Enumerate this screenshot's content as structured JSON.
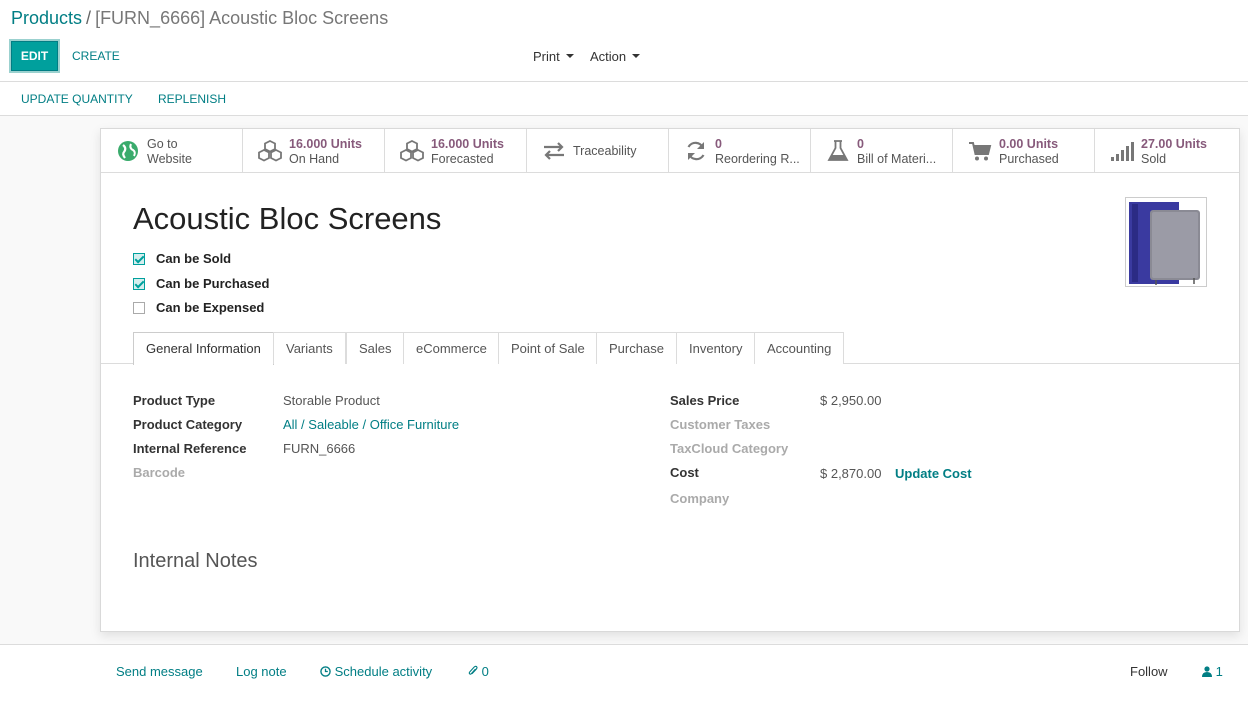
{
  "breadcrumb": {
    "parent": "Products",
    "separator": "/",
    "current": "[FURN_6666] Acoustic Bloc Screens"
  },
  "toolbar": {
    "edit_label": "EDIT",
    "create_label": "CREATE",
    "print_label": "Print",
    "action_label": "Action"
  },
  "status_buttons": {
    "update_quantity": "UPDATE QUANTITY",
    "replenish": "REPLENISH"
  },
  "smart_buttons": [
    {
      "value": "Go to",
      "label": "Website",
      "icon": "globe-icon"
    },
    {
      "value": "16.000 Units",
      "label": "On Hand",
      "icon": "cubes-icon"
    },
    {
      "value": "16.000 Units",
      "label": "Forecasted",
      "icon": "cubes-icon"
    },
    {
      "value": "",
      "label": "Traceability",
      "icon": "exchange-icon"
    },
    {
      "value": "0",
      "label": "Reordering R...",
      "icon": "refresh-icon"
    },
    {
      "value": "0",
      "label": "Bill of Materi...",
      "icon": "flask-icon"
    },
    {
      "value": "0.00 Units",
      "label": "Purchased",
      "icon": "cart-icon"
    },
    {
      "value": "27.00 Units",
      "label": "Sold",
      "icon": "signal-icon"
    }
  ],
  "product": {
    "name": "Acoustic Bloc Screens",
    "can_be_sold": "Can be Sold",
    "can_be_purchased": "Can be Purchased",
    "can_be_expensed": "Can be Expensed",
    "can_be_sold_checked": true,
    "can_be_purchased_checked": true,
    "can_be_expensed_checked": false
  },
  "tabs": [
    "General Information",
    "Variants",
    "Sales",
    "eCommerce",
    "Point of Sale",
    "Purchase",
    "Inventory",
    "Accounting"
  ],
  "general": {
    "product_type_label": "Product Type",
    "product_type_value": "Storable Product",
    "product_category_label": "Product Category",
    "product_category_value": "All / Saleable / Office Furniture",
    "internal_reference_label": "Internal Reference",
    "internal_reference_value": "FURN_6666",
    "barcode_label": "Barcode",
    "sales_price_label": "Sales Price",
    "sales_price_value": "$ 2,950.00",
    "customer_taxes_label": "Customer Taxes",
    "taxcloud_category_label": "TaxCloud Category",
    "cost_label": "Cost",
    "cost_value": "$ 2,870.00",
    "update_cost_label": "Update Cost",
    "company_label": "Company"
  },
  "notes": {
    "title": "Internal Notes"
  },
  "chatter": {
    "send_message": "Send message",
    "log_note": "Log note",
    "schedule_activity": "Schedule activity",
    "attachments_count": "0",
    "follow": "Follow",
    "followers_count": "1"
  },
  "colors": {
    "primary": "#00a09d",
    "link": "#017e84",
    "smart_value": "#875a7b"
  }
}
